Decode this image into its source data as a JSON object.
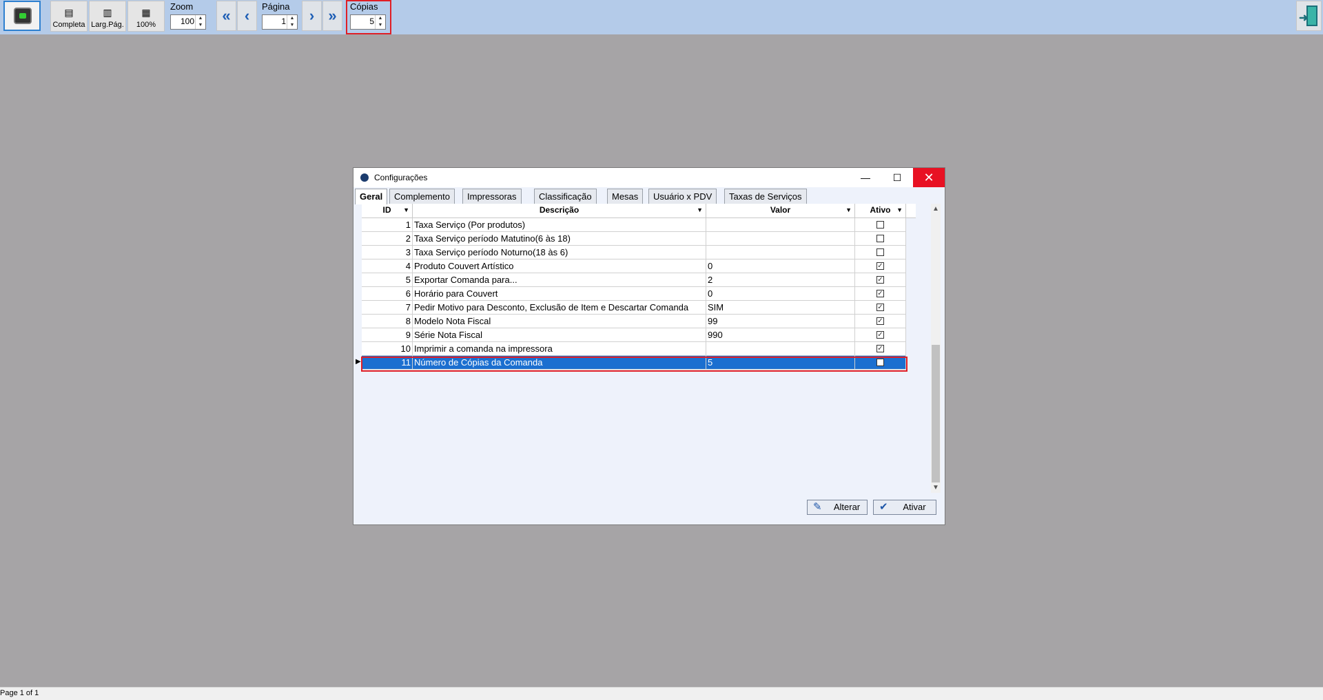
{
  "toolbar": {
    "print_icon": "printer-icon",
    "view_buttons": [
      {
        "label": "Completa",
        "icon": "full-page-icon"
      },
      {
        "label": "Larg.Pág.",
        "icon": "page-width-icon"
      },
      {
        "label": "100%",
        "icon": "actual-size-icon"
      }
    ],
    "zoom": {
      "label": "Zoom",
      "value": "100"
    },
    "nav": {
      "first": "«",
      "prev": "‹",
      "next": "›",
      "last": "»"
    },
    "page": {
      "label": "Página",
      "value": "1"
    },
    "copies": {
      "label": "Cópias",
      "value": "5"
    },
    "exit_icon": "exit-door-icon"
  },
  "status": {
    "text": "Page 1 of 1"
  },
  "dialog": {
    "title": "Configurações",
    "controls": {
      "minimize": "—",
      "maximize": "☐",
      "close": "✕"
    },
    "tabs": [
      "Geral",
      "Complemento",
      "Impressoras",
      "Classificação",
      "Mesas",
      "Usuário x PDV",
      "Taxas de Serviços"
    ],
    "active_tab": "Geral",
    "columns": {
      "id": "ID",
      "descricao": "Descrição",
      "valor": "Valor",
      "ativo": "Ativo"
    },
    "rows": [
      {
        "id": "1",
        "descricao": "Taxa Serviço (Por produtos)",
        "valor": "",
        "ativo": false
      },
      {
        "id": "2",
        "descricao": "Taxa Serviço período Matutino(6 às 18)",
        "valor": "",
        "ativo": false
      },
      {
        "id": "3",
        "descricao": "Taxa Serviço  período Noturno(18 às 6)",
        "valor": "",
        "ativo": false
      },
      {
        "id": "4",
        "descricao": "Produto Couvert Artístico",
        "valor": "0",
        "ativo": true
      },
      {
        "id": "5",
        "descricao": "Exportar Comanda para...",
        "valor": "2",
        "ativo": true
      },
      {
        "id": "6",
        "descricao": "Horário para Couvert",
        "valor": "0",
        "ativo": true
      },
      {
        "id": "7",
        "descricao": "Pedir Motivo para Desconto, Exclusão de Item e Descartar Comanda",
        "valor": "SIM",
        "ativo": true
      },
      {
        "id": "8",
        "descricao": "Modelo Nota Fiscal",
        "valor": "99",
        "ativo": true
      },
      {
        "id": "9",
        "descricao": "Série Nota Fiscal",
        "valor": "990",
        "ativo": true
      },
      {
        "id": "10",
        "descricao": "Imprimir a comanda na impressora",
        "valor": "",
        "ativo": true
      },
      {
        "id": "11",
        "descricao": "Número de Cópias da Comanda",
        "valor": "5",
        "ativo": false,
        "selected": true
      }
    ],
    "buttons": {
      "alterar": {
        "label": "Alterar",
        "icon": "edit-pencil-icon"
      },
      "ativar": {
        "label": "Ativar",
        "icon": "checkmark-icon"
      }
    }
  }
}
